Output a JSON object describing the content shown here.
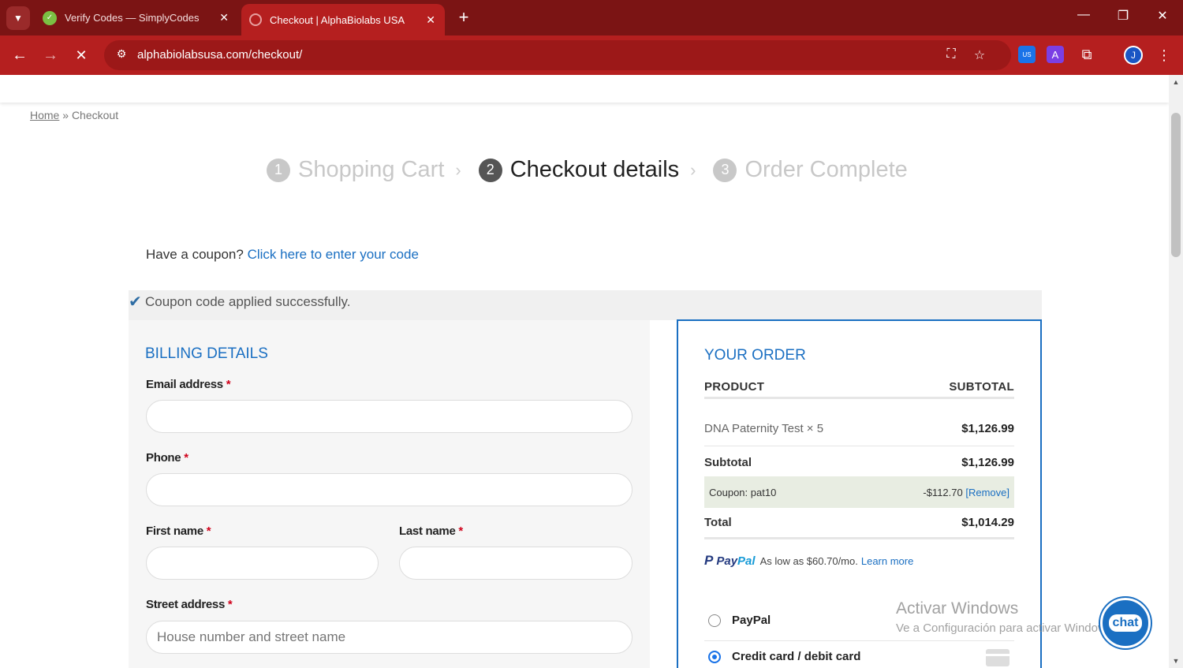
{
  "browser": {
    "tabs": [
      {
        "title": "Verify Codes — SimplyCodes",
        "active": false
      },
      {
        "title": "Checkout | AlphaBiolabs USA",
        "active": true
      }
    ],
    "url": "alphabiolabsusa.com/checkout/",
    "avatar_letter": "J",
    "ext_badge": "US",
    "ext_letter": "A",
    "colors": {
      "frame": "#7b1414",
      "toolbar": "#b51f1f"
    }
  },
  "breadcrumb": {
    "home": "Home",
    "separator": "»",
    "current": "Checkout"
  },
  "steps": [
    {
      "num": "1",
      "label": "Shopping Cart",
      "active": false
    },
    {
      "num": "2",
      "label": "Checkout details",
      "active": true
    },
    {
      "num": "3",
      "label": "Order Complete",
      "active": false
    }
  ],
  "coupon": {
    "prompt": "Have a coupon?",
    "link": "Click here to enter your code"
  },
  "notice": {
    "message": "Coupon code applied successfully."
  },
  "billing": {
    "title": "BILLING DETAILS",
    "fields": {
      "email": {
        "label": "Email address",
        "value": ""
      },
      "phone": {
        "label": "Phone",
        "value": ""
      },
      "first_name": {
        "label": "First name",
        "value": ""
      },
      "last_name": {
        "label": "Last name",
        "value": ""
      },
      "street": {
        "label": "Street address",
        "placeholder": "House number and street name"
      }
    },
    "required_mark": "*"
  },
  "order": {
    "title": "YOUR ORDER",
    "col_product": "PRODUCT",
    "col_subtotal": "SUBTOTAL",
    "item": {
      "name": "DNA Paternity Test",
      "qty": "× 5",
      "amount": "$1,126.99"
    },
    "subtotal": {
      "label": "Subtotal",
      "amount": "$1,126.99"
    },
    "coupon": {
      "label": "Coupon: pat10",
      "amount": "-$112.70",
      "remove": "[Remove]"
    },
    "total": {
      "label": "Total",
      "amount": "$1,014.29"
    },
    "paypal_promo": {
      "logo_pay": "Pay",
      "logo_pal": "Pal",
      "text": "As low as $60.70/mo.",
      "link": "Learn more"
    },
    "payment_options": [
      {
        "label": "PayPal",
        "selected": false
      },
      {
        "label": "Credit card / debit card",
        "selected": true
      }
    ]
  },
  "watermark": {
    "line1": "Activar Windows",
    "line2": "Ve a Configuración para activar Windows."
  },
  "chat": {
    "label": "chat"
  }
}
